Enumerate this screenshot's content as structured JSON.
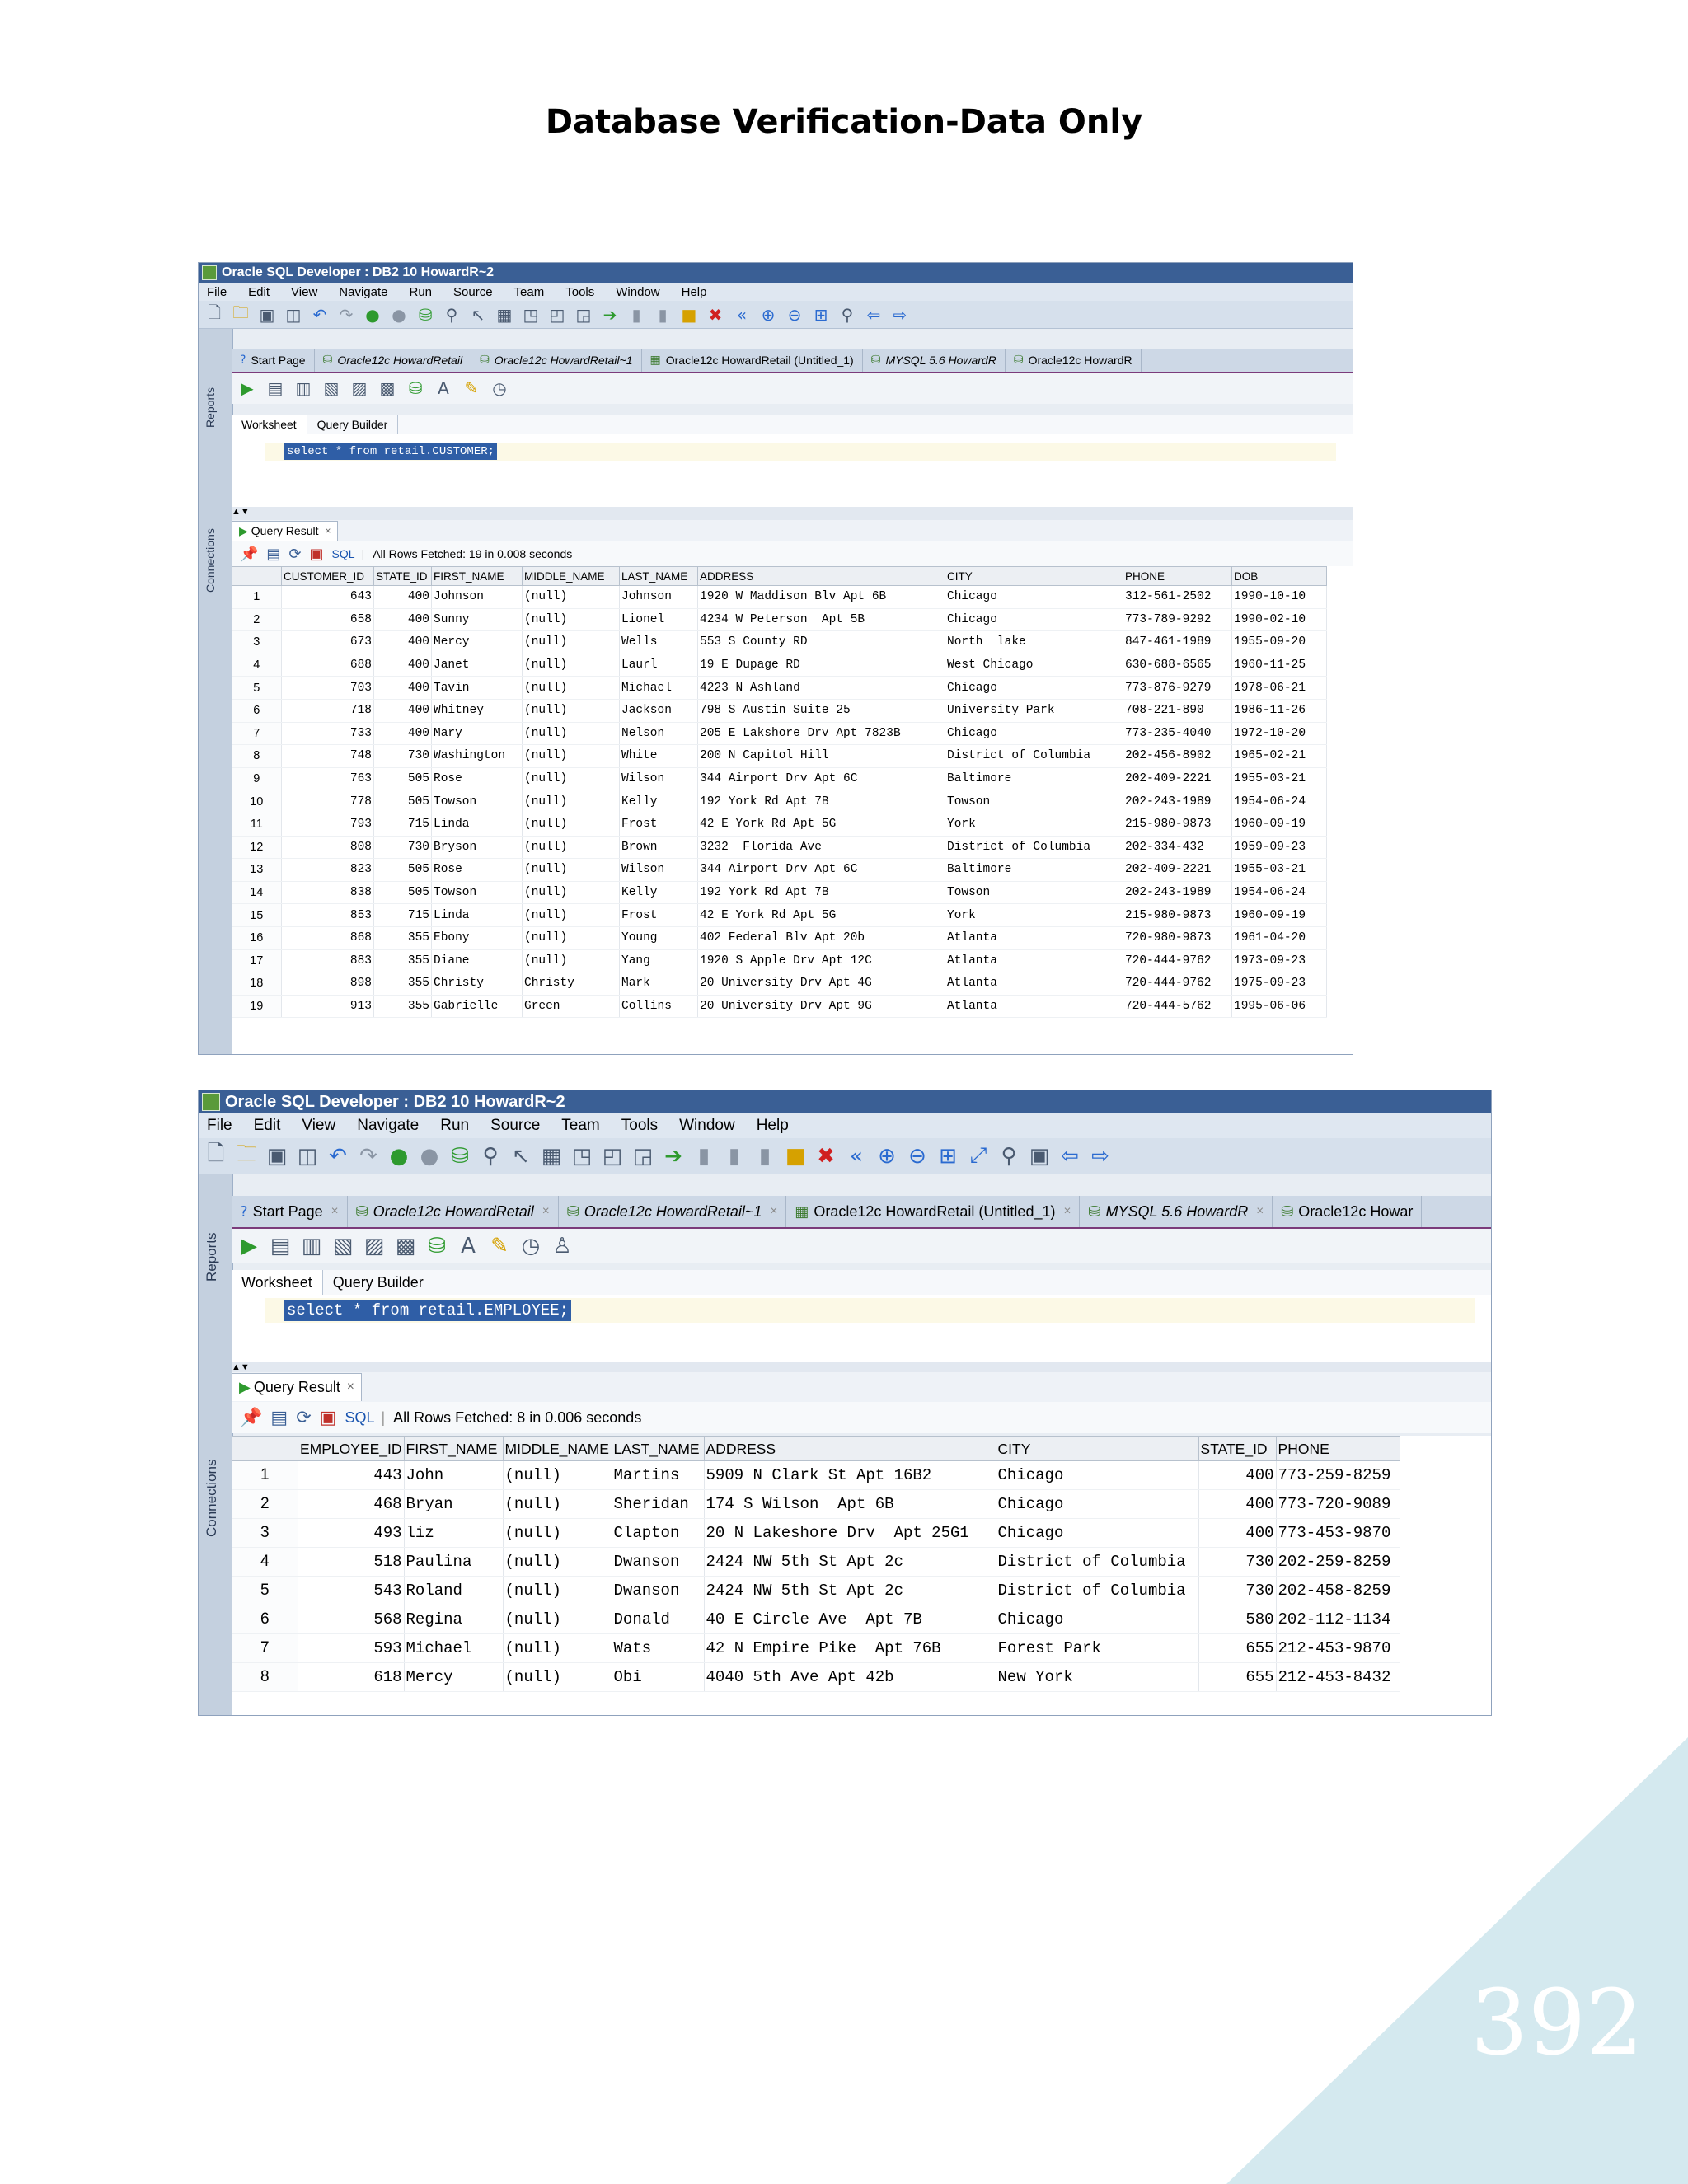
{
  "page_title": "Database Verification-Data Only",
  "page_number": "392",
  "windows": [
    {
      "title": "Oracle SQL Developer : DB2 10 HowardR~2",
      "menu": [
        "File",
        "Edit",
        "View",
        "Navigate",
        "Run",
        "Source",
        "Team",
        "Tools",
        "Window",
        "Help"
      ],
      "side_labels": {
        "reports": "Reports",
        "connections": "Connections"
      },
      "tabs": [
        {
          "label": "Start Page",
          "italic": false,
          "icon": "help-icon"
        },
        {
          "label": "Oracle12c HowardRetail",
          "italic": true,
          "icon": "sql-worksheet-icon"
        },
        {
          "label": "Oracle12c HowardRetail~1",
          "italic": true,
          "icon": "sql-worksheet-icon"
        },
        {
          "label": "Oracle12c HowardRetail (Untitled_1)",
          "italic": false,
          "icon": "data-grid-icon"
        },
        {
          "label": "MYSQL 5.6 HowardR",
          "italic": true,
          "icon": "sql-worksheet-icon"
        },
        {
          "label": "Oracle12c HowardR",
          "italic": false,
          "icon": "sql-worksheet-icon"
        }
      ],
      "subtabs": {
        "worksheet": "Worksheet",
        "query_builder": "Query Builder"
      },
      "sql": "select * from retail.CUSTOMER;",
      "result_tab": "Query Result",
      "sql_link": "SQL",
      "fetch_status": "All Rows Fetched: 19 in 0.008 seconds",
      "columns": [
        "CUSTOMER_ID",
        "STATE_ID",
        "FIRST_NAME",
        "MIDDLE_NAME",
        "LAST_NAME",
        "ADDRESS",
        "CITY",
        "PHONE",
        "DOB"
      ],
      "rows": [
        [
          "1",
          "643",
          "400",
          "Johnson",
          "(null)",
          "Johnson",
          "1920 W Maddison Blv Apt 6B",
          "Chicago",
          "312-561-2502",
          "1990-10-10"
        ],
        [
          "2",
          "658",
          "400",
          "Sunny",
          "(null)",
          "Lionel",
          "4234 W Peterson  Apt 5B",
          "Chicago",
          "773-789-9292",
          "1990-02-10"
        ],
        [
          "3",
          "673",
          "400",
          "Mercy",
          "(null)",
          "Wells",
          "553 S County RD",
          "North  lake",
          "847-461-1989",
          "1955-09-20"
        ],
        [
          "4",
          "688",
          "400",
          "Janet",
          "(null)",
          "Laurl",
          "19 E Dupage RD",
          "West Chicago",
          "630-688-6565",
          "1960-11-25"
        ],
        [
          "5",
          "703",
          "400",
          "Tavin",
          "(null)",
          "Michael",
          "4223 N Ashland",
          "Chicago",
          "773-876-9279",
          "1978-06-21"
        ],
        [
          "6",
          "718",
          "400",
          "Whitney",
          "(null)",
          "Jackson",
          "798 S Austin Suite 25",
          "University Park",
          "708-221-890",
          "1986-11-26"
        ],
        [
          "7",
          "733",
          "400",
          "Mary",
          "(null)",
          "Nelson",
          "205 E Lakshore Drv Apt 7823B",
          "Chicago",
          "773-235-4040",
          "1972-10-20"
        ],
        [
          "8",
          "748",
          "730",
          "Washington",
          "(null)",
          "White",
          "200 N Capitol Hill",
          "District of Columbia",
          "202-456-8902",
          "1965-02-21"
        ],
        [
          "9",
          "763",
          "505",
          "Rose",
          "(null)",
          "Wilson",
          "344 Airport Drv Apt 6C",
          "Baltimore",
          "202-409-2221",
          "1955-03-21"
        ],
        [
          "10",
          "778",
          "505",
          "Towson",
          "(null)",
          "Kelly",
          "192 York Rd Apt 7B",
          "Towson",
          "202-243-1989",
          "1954-06-24"
        ],
        [
          "11",
          "793",
          "715",
          "Linda",
          "(null)",
          "Frost",
          "42 E York Rd Apt 5G",
          "York",
          "215-980-9873",
          "1960-09-19"
        ],
        [
          "12",
          "808",
          "730",
          "Bryson",
          "(null)",
          "Brown",
          "3232  Florida Ave",
          "District of Columbia",
          "202-334-432",
          "1959-09-23"
        ],
        [
          "13",
          "823",
          "505",
          "Rose",
          "(null)",
          "Wilson",
          "344 Airport Drv Apt 6C",
          "Baltimore",
          "202-409-2221",
          "1955-03-21"
        ],
        [
          "14",
          "838",
          "505",
          "Towson",
          "(null)",
          "Kelly",
          "192 York Rd Apt 7B",
          "Towson",
          "202-243-1989",
          "1954-06-24"
        ],
        [
          "15",
          "853",
          "715",
          "Linda",
          "(null)",
          "Frost",
          "42 E York Rd Apt 5G",
          "York",
          "215-980-9873",
          "1960-09-19"
        ],
        [
          "16",
          "868",
          "355",
          "Ebony",
          "(null)",
          "Young",
          "402 Federal Blv Apt 20b",
          "Atlanta",
          "720-980-9873",
          "1961-04-20"
        ],
        [
          "17",
          "883",
          "355",
          "Diane",
          "(null)",
          "Yang",
          "1920 S Apple Drv Apt 12C",
          "Atlanta",
          "720-444-9762",
          "1973-09-23"
        ],
        [
          "18",
          "898",
          "355",
          "Christy",
          "Christy",
          "Mark",
          "20 University Drv Apt 4G",
          "Atlanta",
          "720-444-9762",
          "1975-09-23"
        ],
        [
          "19",
          "913",
          "355",
          "Gabrielle",
          "Green",
          "Collins",
          "20 University Drv Apt 9G",
          "Atlanta",
          "720-444-5762",
          "1995-06-06"
        ]
      ]
    },
    {
      "title": "Oracle SQL Developer : DB2 10 HowardR~2",
      "menu": [
        "File",
        "Edit",
        "View",
        "Navigate",
        "Run",
        "Source",
        "Team",
        "Tools",
        "Window",
        "Help"
      ],
      "side_labels": {
        "reports": "Reports",
        "connections": "Connections"
      },
      "tabs": [
        {
          "label": "Start Page",
          "italic": false,
          "icon": "help-icon"
        },
        {
          "label": "Oracle12c HowardRetail",
          "italic": true,
          "icon": "sql-worksheet-icon"
        },
        {
          "label": "Oracle12c HowardRetail~1",
          "italic": true,
          "icon": "sql-worksheet-icon"
        },
        {
          "label": "Oracle12c HowardRetail (Untitled_1)",
          "italic": false,
          "icon": "data-grid-icon"
        },
        {
          "label": "MYSQL 5.6 HowardR",
          "italic": true,
          "icon": "sql-worksheet-icon"
        },
        {
          "label": "Oracle12c Howar",
          "italic": false,
          "icon": "sql-worksheet-icon"
        }
      ],
      "subtabs": {
        "worksheet": "Worksheet",
        "query_builder": "Query Builder"
      },
      "sql": "select * from retail.EMPLOYEE;",
      "result_tab": "Query Result",
      "sql_link": "SQL",
      "fetch_status": "All Rows Fetched: 8 in 0.006 seconds",
      "columns": [
        "EMPLOYEE_ID",
        "FIRST_NAME",
        "MIDDLE_NAME",
        "LAST_NAME",
        "ADDRESS",
        "CITY",
        "STATE_ID",
        "PHONE"
      ],
      "rows": [
        [
          "1",
          "443",
          "John",
          "(null)",
          "Martins",
          "5909 N Clark St Apt 16B2",
          "Chicago",
          "400",
          "773-259-8259"
        ],
        [
          "2",
          "468",
          "Bryan",
          "(null)",
          "Sheridan",
          "174 S Wilson  Apt 6B",
          "Chicago",
          "400",
          "773-720-9089"
        ],
        [
          "3",
          "493",
          "liz",
          "(null)",
          "Clapton",
          "20 N Lakeshore Drv  Apt 25G1",
          "Chicago",
          "400",
          "773-453-9870"
        ],
        [
          "4",
          "518",
          "Paulina",
          "(null)",
          "Dwanson",
          "2424 NW 5th St Apt 2c",
          "District of Columbia",
          "730",
          "202-259-8259"
        ],
        [
          "5",
          "543",
          "Roland",
          "(null)",
          "Dwanson",
          "2424 NW 5th St Apt 2c",
          "District of Columbia",
          "730",
          "202-458-8259"
        ],
        [
          "6",
          "568",
          "Regina",
          "(null)",
          "Donald",
          "40 E Circle Ave  Apt 7B",
          "Chicago",
          "580",
          "202-112-1134"
        ],
        [
          "7",
          "593",
          "Michael",
          "(null)",
          "Wats",
          "42 N Empire Pike  Apt 76B",
          "Forest Park",
          "655",
          "212-453-9870"
        ],
        [
          "8",
          "618",
          "Mercy",
          "(null)",
          "Obi",
          "4040 5th Ave Apt 42b",
          "New York",
          "655",
          "212-453-8432"
        ]
      ]
    }
  ]
}
